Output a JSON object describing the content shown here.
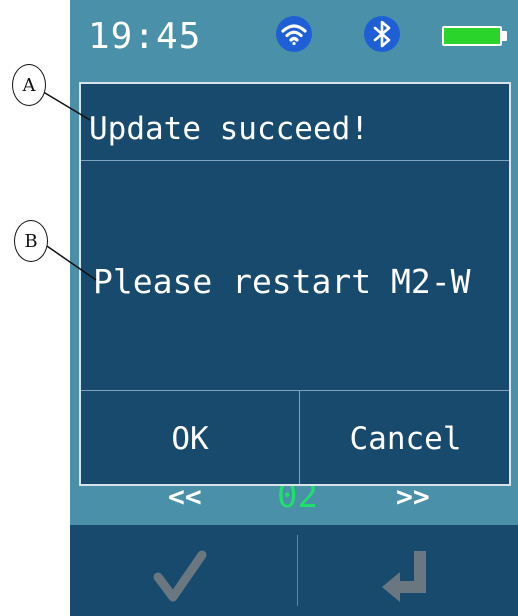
{
  "status_bar": {
    "time": "19:45",
    "icons": [
      "wifi-icon",
      "bluetooth-icon",
      "battery-icon"
    ],
    "battery_color": "#2bd42b",
    "icon_bg_color": "#1f5fd6"
  },
  "pager": {
    "prev_label": "<<",
    "page_number": "02",
    "next_label": ">>"
  },
  "dialog": {
    "title": "Update succeed!",
    "message": "Please restart M2-W",
    "ok_label": "OK",
    "cancel_label": "Cancel"
  },
  "bottom_bar": {
    "icons": [
      "checkmark-icon",
      "enter-icon"
    ]
  },
  "annotations": {
    "a": "A",
    "b": "B"
  },
  "colors": {
    "screen_bg": "#4a90a8",
    "dialog_bg": "#174a6c",
    "text": "#ffffff"
  }
}
